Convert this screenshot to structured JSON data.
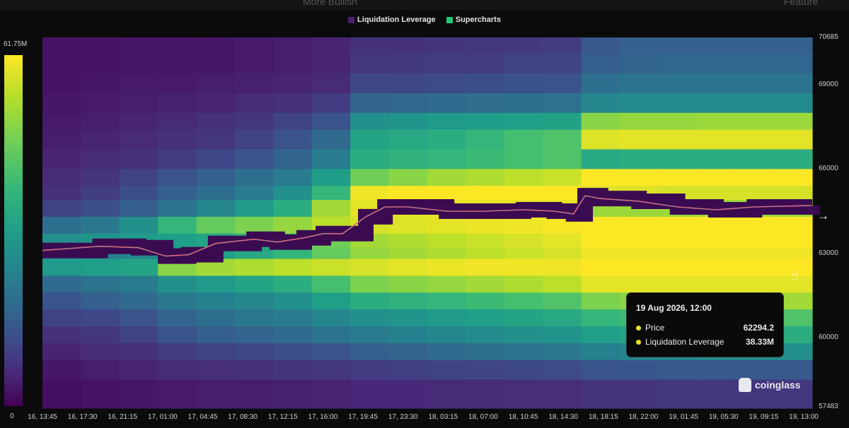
{
  "header": {
    "title_fragment": "More Bullish",
    "right_fragment": "Feature"
  },
  "legend": {
    "items": [
      {
        "label": "Liquidation Leverage",
        "color": "#4a1f6e"
      },
      {
        "label": "Supercharts",
        "color": "#22c77a"
      }
    ]
  },
  "colorbar": {
    "max_label": "61.75M",
    "min_label": "0"
  },
  "tooltip": {
    "date": "19 Aug 2026, 12:00",
    "rows": [
      {
        "label": "Price",
        "value": "62294.2"
      },
      {
        "label": "Liquidation Leverage",
        "value": "38.33M"
      }
    ]
  },
  "brand": {
    "name": "coinglass"
  },
  "chart_data": {
    "type": "heatmap",
    "x_tick_labels": [
      "16, 13:45",
      "16, 17:30",
      "16, 21:15",
      "17, 01:00",
      "17, 04:45",
      "17, 08:30",
      "17, 12:15",
      "17, 16:00",
      "17, 19:45",
      "17, 23:30",
      "18, 03:15",
      "18, 07:00",
      "18, 10:45",
      "18, 14:30",
      "18, 18:15",
      "18, 22:00",
      "19, 01:45",
      "19, 05:30",
      "19, 09:15",
      "19, 13:00"
    ],
    "y_tick_labels": [
      "70685",
      "69000",
      "66000",
      "63000",
      "60000",
      "57483"
    ],
    "ylim": [
      57483,
      70685
    ],
    "colorbar_range": [
      0,
      61.75
    ],
    "colorbar_unit": "M",
    "price_series": {
      "name": "Price",
      "x_index": [
        0,
        1,
        2,
        2.7,
        3.3,
        4,
        5,
        5.6,
        6.3,
        6.8,
        7.3,
        7.9,
        8.4,
        9,
        10,
        11,
        12,
        12.8,
        13.3,
        13.6,
        14,
        15,
        16,
        17,
        18,
        19
      ],
      "y": [
        63100,
        63250,
        63200,
        62900,
        62950,
        63350,
        63500,
        63400,
        63550,
        63700,
        63700,
        64300,
        64650,
        64650,
        64500,
        64500,
        64550,
        64500,
        64400,
        65050,
        64950,
        64850,
        64650,
        64550,
        64650,
        64700
      ]
    },
    "liquidation_bands": [
      {
        "y_from": 70100,
        "y_to": 70685,
        "intensity": [
          0.05,
          0.05,
          0.06,
          0.06,
          0.06,
          0.07,
          0.08,
          0.1,
          0.14,
          0.14,
          0.15,
          0.16,
          0.17,
          0.18,
          0.28,
          0.3,
          0.3,
          0.3,
          0.3,
          0.3
        ]
      },
      {
        "y_from": 69400,
        "y_to": 70100,
        "intensity": [
          0.05,
          0.05,
          0.06,
          0.06,
          0.06,
          0.07,
          0.08,
          0.1,
          0.16,
          0.17,
          0.18,
          0.18,
          0.2,
          0.21,
          0.3,
          0.32,
          0.33,
          0.33,
          0.33,
          0.33
        ]
      },
      {
        "y_from": 68700,
        "y_to": 69400,
        "intensity": [
          0.05,
          0.06,
          0.07,
          0.07,
          0.08,
          0.09,
          0.1,
          0.12,
          0.22,
          0.22,
          0.23,
          0.24,
          0.25,
          0.26,
          0.36,
          0.38,
          0.38,
          0.38,
          0.38,
          0.38
        ]
      },
      {
        "y_from": 68000,
        "y_to": 68700,
        "intensity": [
          0.06,
          0.07,
          0.08,
          0.09,
          0.1,
          0.12,
          0.14,
          0.18,
          0.32,
          0.33,
          0.34,
          0.35,
          0.36,
          0.37,
          0.46,
          0.48,
          0.48,
          0.48,
          0.48,
          0.48
        ]
      },
      {
        "y_from": 67400,
        "y_to": 68000,
        "intensity": [
          0.07,
          0.08,
          0.1,
          0.12,
          0.14,
          0.16,
          0.2,
          0.26,
          0.5,
          0.52,
          0.54,
          0.55,
          0.56,
          0.57,
          0.82,
          0.84,
          0.84,
          0.85,
          0.85,
          0.85
        ]
      },
      {
        "y_from": 66700,
        "y_to": 67400,
        "intensity": [
          0.08,
          0.1,
          0.12,
          0.14,
          0.16,
          0.2,
          0.26,
          0.34,
          0.58,
          0.6,
          0.62,
          0.66,
          0.7,
          0.72,
          0.95,
          0.96,
          0.96,
          0.96,
          0.96,
          0.96
        ]
      },
      {
        "y_from": 66000,
        "y_to": 66700,
        "intensity": [
          0.1,
          0.12,
          0.14,
          0.18,
          0.22,
          0.26,
          0.32,
          0.42,
          0.62,
          0.64,
          0.66,
          0.68,
          0.7,
          0.72,
          0.6,
          0.62,
          0.62,
          0.62,
          0.62,
          0.62
        ]
      },
      {
        "y_from": 65400,
        "y_to": 66000,
        "intensity": [
          0.12,
          0.15,
          0.2,
          0.26,
          0.3,
          0.36,
          0.42,
          0.55,
          0.78,
          0.82,
          0.86,
          0.88,
          0.9,
          0.92,
          1.0,
          1.0,
          1.0,
          1.0,
          1.0,
          1.0
        ]
      },
      {
        "y_from": 64900,
        "y_to": 65400,
        "intensity": [
          0.14,
          0.18,
          0.24,
          0.3,
          0.36,
          0.42,
          0.5,
          0.66,
          0.98,
          1.0,
          1.0,
          1.0,
          1.0,
          1.0,
          0.95,
          0.95,
          0.94,
          0.94,
          0.94,
          0.94
        ]
      },
      {
        "y_from": 64300,
        "y_to": 64900,
        "intensity": [
          0.2,
          0.24,
          0.3,
          0.38,
          0.46,
          0.54,
          0.62,
          0.86,
          0.96,
          0.96,
          0.96,
          0.96,
          0.96,
          0.96,
          0.85,
          0.85,
          0.85,
          0.85,
          0.85,
          0.85
        ]
      },
      {
        "y_from": 63700,
        "y_to": 64300,
        "intensity": [
          0.36,
          0.4,
          0.5,
          0.66,
          0.76,
          0.8,
          0.84,
          0.9,
          0.94,
          0.95,
          0.96,
          0.97,
          0.98,
          0.99,
          1.0,
          1.0,
          1.0,
          1.0,
          1.0,
          1.0
        ]
      },
      {
        "y_from": 63200,
        "y_to": 63700,
        "intensity": [
          0.5,
          0.52,
          0.54,
          0.56,
          0.58,
          0.62,
          0.66,
          0.78,
          0.86,
          0.88,
          0.9,
          0.92,
          0.94,
          0.96,
          1.0,
          1.0,
          1.0,
          1.0,
          1.0,
          1.0
        ]
      },
      {
        "y_from": 62800,
        "y_to": 63200,
        "intensity": [
          0.42,
          0.44,
          0.46,
          0.52,
          0.56,
          0.6,
          0.66,
          0.76,
          0.84,
          0.86,
          0.88,
          0.9,
          0.92,
          0.94,
          0.98,
          0.98,
          0.98,
          0.98,
          0.98,
          0.98
        ]
      },
      {
        "y_from": 62200,
        "y_to": 62800,
        "intensity": [
          0.54,
          0.56,
          0.58,
          0.82,
          0.86,
          0.88,
          0.9,
          0.92,
          0.94,
          0.96,
          0.97,
          0.98,
          0.98,
          0.98,
          1.0,
          1.0,
          1.0,
          1.0,
          1.0,
          1.0
        ]
      },
      {
        "y_from": 61600,
        "y_to": 62200,
        "intensity": [
          0.34,
          0.38,
          0.42,
          0.5,
          0.54,
          0.58,
          0.62,
          0.7,
          0.8,
          0.82,
          0.84,
          0.86,
          0.88,
          0.9,
          0.96,
          0.96,
          0.96,
          0.96,
          0.96,
          0.96
        ]
      },
      {
        "y_from": 61000,
        "y_to": 61600,
        "intensity": [
          0.26,
          0.3,
          0.34,
          0.4,
          0.44,
          0.46,
          0.5,
          0.56,
          0.62,
          0.64,
          0.66,
          0.68,
          0.7,
          0.72,
          0.8,
          0.82,
          0.84,
          0.86,
          0.86,
          0.86
        ]
      },
      {
        "y_from": 60400,
        "y_to": 61000,
        "intensity": [
          0.2,
          0.22,
          0.26,
          0.32,
          0.36,
          0.4,
          0.42,
          0.46,
          0.5,
          0.52,
          0.54,
          0.56,
          0.58,
          0.6,
          0.66,
          0.68,
          0.7,
          0.72,
          0.72,
          0.72
        ]
      },
      {
        "y_from": 59800,
        "y_to": 60400,
        "intensity": [
          0.14,
          0.16,
          0.2,
          0.26,
          0.3,
          0.32,
          0.34,
          0.38,
          0.42,
          0.44,
          0.46,
          0.48,
          0.5,
          0.52,
          0.56,
          0.58,
          0.6,
          0.62,
          0.62,
          0.62
        ]
      },
      {
        "y_from": 59200,
        "y_to": 59800,
        "intensity": [
          0.1,
          0.12,
          0.14,
          0.18,
          0.2,
          0.22,
          0.24,
          0.26,
          0.3,
          0.32,
          0.34,
          0.36,
          0.38,
          0.4,
          0.44,
          0.46,
          0.48,
          0.5,
          0.5,
          0.5
        ]
      },
      {
        "y_from": 58500,
        "y_to": 59200,
        "intensity": [
          0.06,
          0.08,
          0.1,
          0.12,
          0.13,
          0.14,
          0.15,
          0.16,
          0.18,
          0.19,
          0.2,
          0.21,
          0.22,
          0.23,
          0.26,
          0.27,
          0.28,
          0.28,
          0.28,
          0.28
        ]
      },
      {
        "y_from": 57483,
        "y_to": 58500,
        "intensity": [
          0.04,
          0.05,
          0.06,
          0.07,
          0.08,
          0.08,
          0.09,
          0.1,
          0.11,
          0.11,
          0.12,
          0.12,
          0.13,
          0.13,
          0.15,
          0.15,
          0.16,
          0.16,
          0.16,
          0.16
        ]
      }
    ]
  }
}
